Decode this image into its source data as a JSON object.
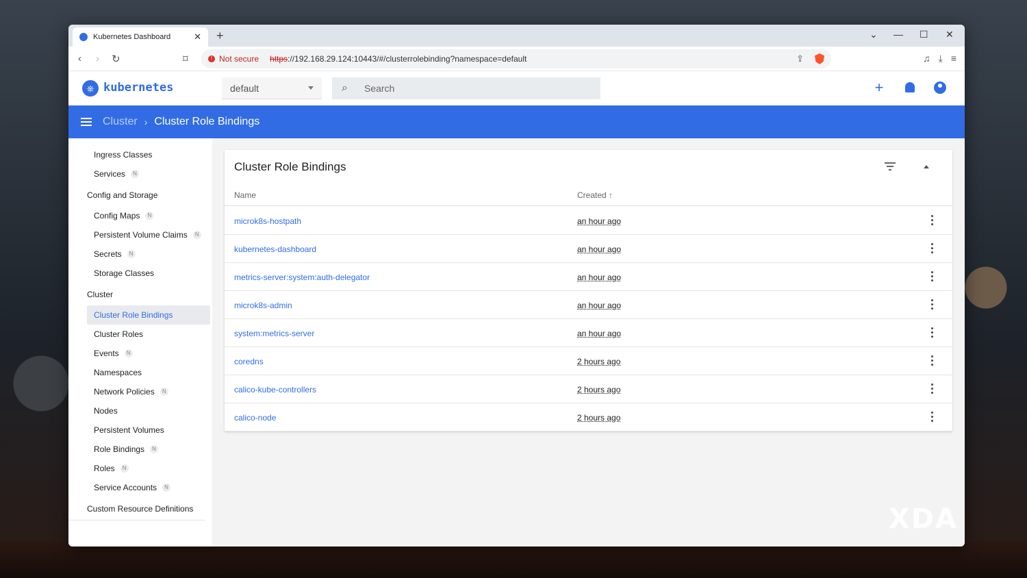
{
  "browser": {
    "tab_title": "Kubernetes Dashboard",
    "security_label": "Not secure",
    "url_scheme": "https",
    "url_rest": "://192.168.29.124:10443/#/clusterrolebinding?namespace=default"
  },
  "app": {
    "brand": "kubernetes",
    "namespace": "default",
    "search_placeholder": "Search"
  },
  "breadcrumb": {
    "parent": "Cluster",
    "current": "Cluster Role Bindings"
  },
  "sidebar": {
    "top_items": [
      {
        "label": "Ingress Classes",
        "badge": ""
      },
      {
        "label": "Services",
        "badge": "N"
      }
    ],
    "config_section": "Config and Storage",
    "config_items": [
      {
        "label": "Config Maps",
        "badge": "N"
      },
      {
        "label": "Persistent Volume Claims",
        "badge": "N"
      },
      {
        "label": "Secrets",
        "badge": "N"
      },
      {
        "label": "Storage Classes",
        "badge": ""
      }
    ],
    "cluster_section": "Cluster",
    "cluster_items": [
      {
        "label": "Cluster Role Bindings",
        "badge": ""
      },
      {
        "label": "Cluster Roles",
        "badge": ""
      },
      {
        "label": "Events",
        "badge": "N"
      },
      {
        "label": "Namespaces",
        "badge": ""
      },
      {
        "label": "Network Policies",
        "badge": "N"
      },
      {
        "label": "Nodes",
        "badge": ""
      },
      {
        "label": "Persistent Volumes",
        "badge": ""
      },
      {
        "label": "Role Bindings",
        "badge": "N"
      },
      {
        "label": "Roles",
        "badge": "N"
      },
      {
        "label": "Service Accounts",
        "badge": "N"
      }
    ],
    "crd_section": "Custom Resource Definitions"
  },
  "card": {
    "title": "Cluster Role Bindings",
    "col_name": "Name",
    "col_created": "Created",
    "rows": [
      {
        "name": "microk8s-hostpath",
        "created": "an hour ago"
      },
      {
        "name": "kubernetes-dashboard",
        "created": "an hour ago"
      },
      {
        "name": "metrics-server:system:auth-delegator",
        "created": "an hour ago"
      },
      {
        "name": "microk8s-admin",
        "created": "an hour ago"
      },
      {
        "name": "system:metrics-server",
        "created": "an hour ago"
      },
      {
        "name": "coredns",
        "created": "2 hours ago"
      },
      {
        "name": "calico-kube-controllers",
        "created": "2 hours ago"
      },
      {
        "name": "calico-node",
        "created": "2 hours ago"
      }
    ]
  },
  "watermark": "XDA",
  "colors": {
    "accent": "#326ce5",
    "insecure": "#c5221f"
  }
}
